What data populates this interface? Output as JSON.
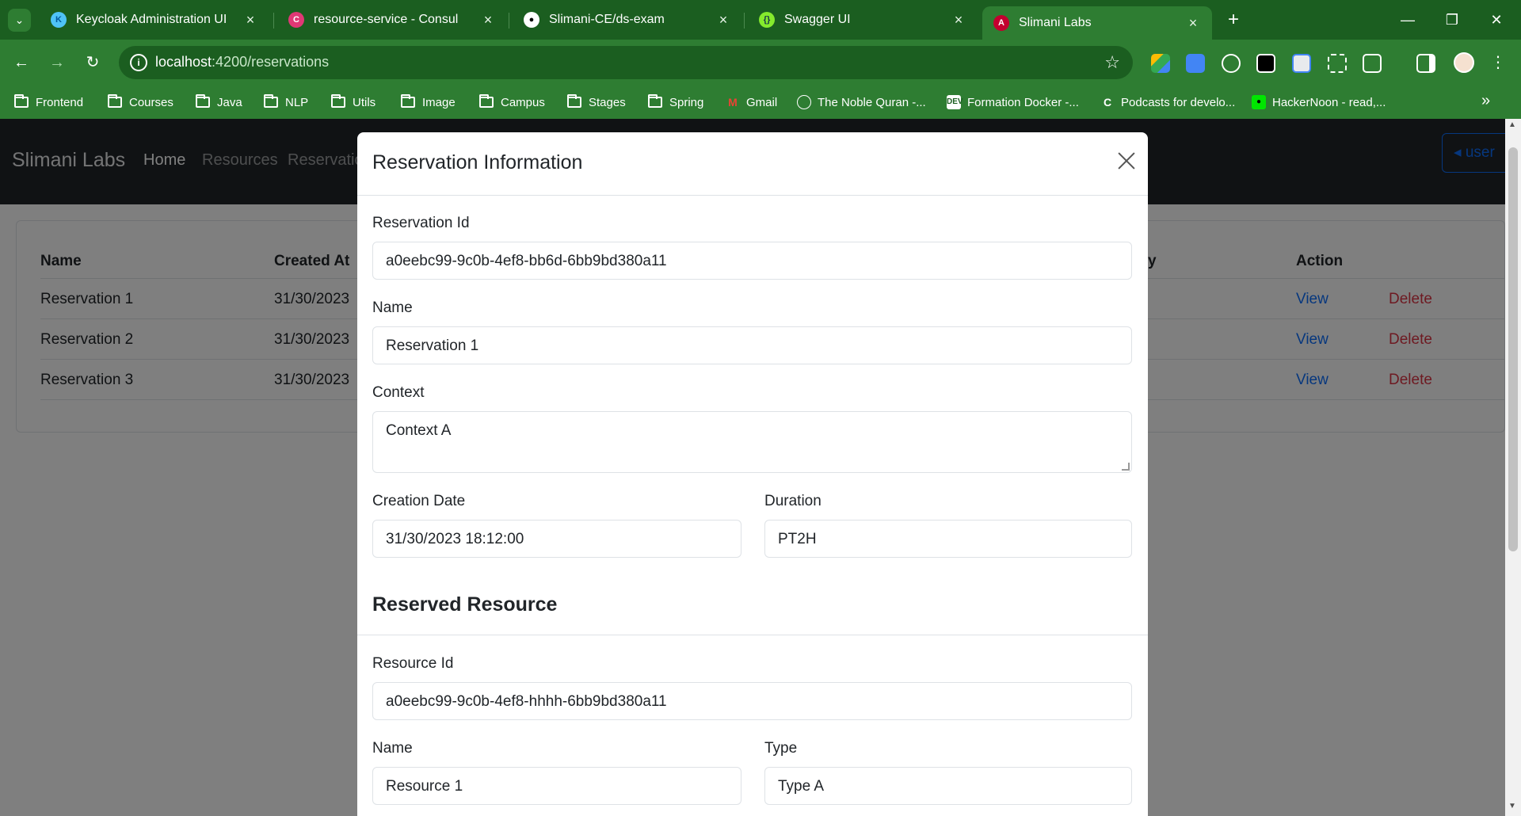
{
  "browser": {
    "tabs": [
      {
        "title": "Keycloak Administration UI",
        "favicon": "keycloak-icon"
      },
      {
        "title": "resource-service - Consul",
        "favicon": "consul-icon"
      },
      {
        "title": "Slimani-CE/ds-exam",
        "favicon": "github-icon"
      },
      {
        "title": "Swagger UI",
        "favicon": "swagger-icon"
      },
      {
        "title": "Slimani Labs",
        "favicon": "angular-icon",
        "active": true
      }
    ],
    "url_host": "localhost",
    "url_rest": ":4200/reservations",
    "bookmarks": [
      {
        "label": "Frontend",
        "icon": "folder-icon"
      },
      {
        "label": "Courses",
        "icon": "folder-icon"
      },
      {
        "label": "Java",
        "icon": "folder-icon"
      },
      {
        "label": "NLP",
        "icon": "folder-icon"
      },
      {
        "label": "Utils",
        "icon": "folder-icon"
      },
      {
        "label": "Image",
        "icon": "folder-icon"
      },
      {
        "label": "Campus",
        "icon": "folder-icon"
      },
      {
        "label": "Stages",
        "icon": "folder-icon"
      },
      {
        "label": "Spring",
        "icon": "folder-icon"
      },
      {
        "label": "Gmail",
        "icon": "gmail-icon"
      },
      {
        "label": "The Noble Quran -...",
        "icon": "quran-icon"
      },
      {
        "label": "Formation Docker -...",
        "icon": "dev-icon"
      },
      {
        "label": "Podcasts for develo...",
        "icon": "podcast-icon"
      },
      {
        "label": "HackerNoon - read,...",
        "icon": "hackernoon-icon"
      }
    ],
    "accent_color": "#2e7d32"
  },
  "app": {
    "brand": "Slimani Labs",
    "nav": [
      "Home",
      "Resources",
      "Reservatio"
    ],
    "user_button": "user"
  },
  "table": {
    "headers": {
      "name": "Name",
      "created_at": "Created At",
      "partial": "y",
      "action": "Action"
    },
    "rows": [
      {
        "name": "Reservation 1",
        "created_at": "31/30/2023",
        "view": "View",
        "delete": "Delete"
      },
      {
        "name": "Reservation 2",
        "created_at": "31/30/2023",
        "view": "View",
        "delete": "Delete"
      },
      {
        "name": "Reservation 3",
        "created_at": "31/30/2023",
        "view": "View",
        "delete": "Delete"
      }
    ]
  },
  "modal": {
    "title": "Reservation Information",
    "reservation_id_label": "Reservation Id",
    "reservation_id": "a0eebc99-9c0b-4ef8-bb6d-6bb9bd380a11",
    "name_label": "Name",
    "name": "Reservation 1",
    "context_label": "Context",
    "context": "Context A",
    "creation_date_label": "Creation Date",
    "creation_date": "31/30/2023 18:12:00",
    "duration_label": "Duration",
    "duration": "PT2H",
    "resource_section": "Reserved Resource",
    "resource_id_label": "Resource Id",
    "resource_id": "a0eebc99-9c0b-4ef8-hhhh-6bb9bd380a11",
    "resource_name_label": "Name",
    "resource_name": "Resource 1",
    "type_label": "Type",
    "type": "Type A"
  }
}
